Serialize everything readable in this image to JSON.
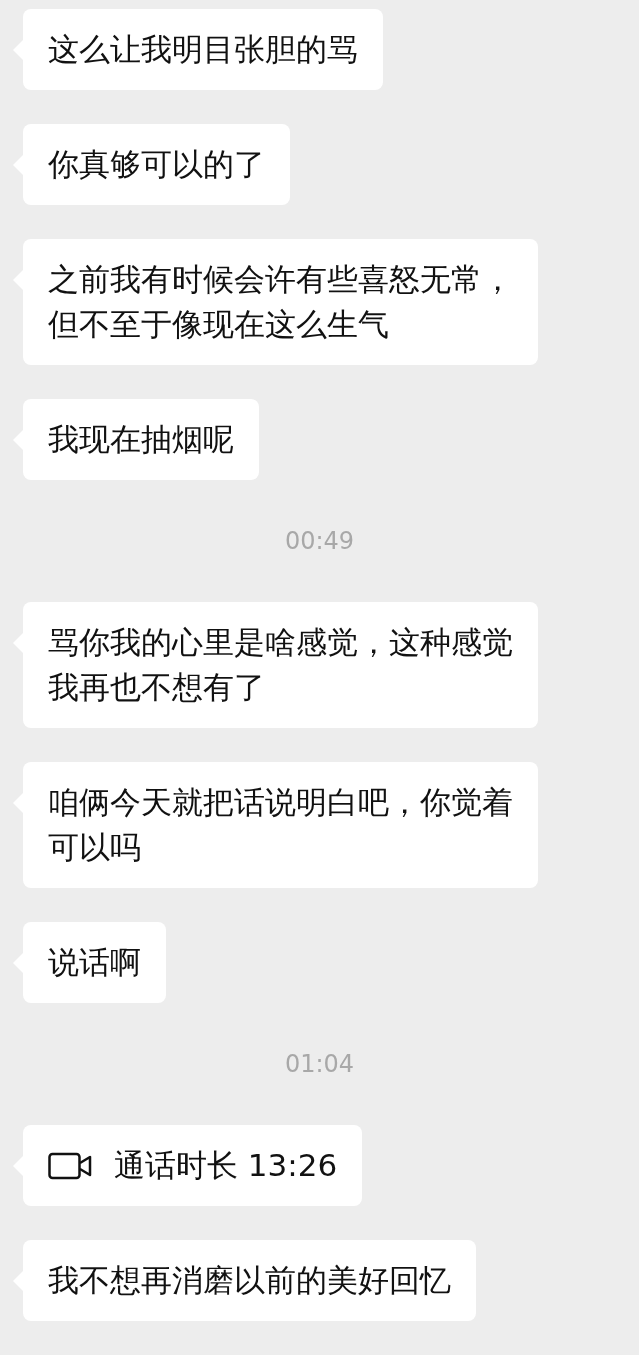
{
  "messages": [
    {
      "kind": "text",
      "lines": [
        "这么让我明目张胆的骂"
      ]
    },
    {
      "kind": "text",
      "lines": [
        "你真够可以的了"
      ]
    },
    {
      "kind": "text",
      "lines": [
        "之前我有时候会许有些喜怒无常，",
        "但不至于像现在这么生气"
      ]
    },
    {
      "kind": "text",
      "lines": [
        "我现在抽烟呢"
      ]
    },
    {
      "kind": "time",
      "text": "00:49"
    },
    {
      "kind": "text",
      "lines": [
        "骂你我的心里是啥感觉，这种感觉",
        "我再也不想有了"
      ]
    },
    {
      "kind": "text",
      "lines": [
        "咱俩今天就把话说明白吧，你觉着",
        "可以吗"
      ]
    },
    {
      "kind": "text",
      "lines": [
        "说话啊"
      ]
    },
    {
      "kind": "time",
      "text": "01:04"
    },
    {
      "kind": "call",
      "text": "通话时长 13:26"
    },
    {
      "kind": "text",
      "lines": [
        "我不想再消磨以前的美好回忆"
      ]
    }
  ]
}
